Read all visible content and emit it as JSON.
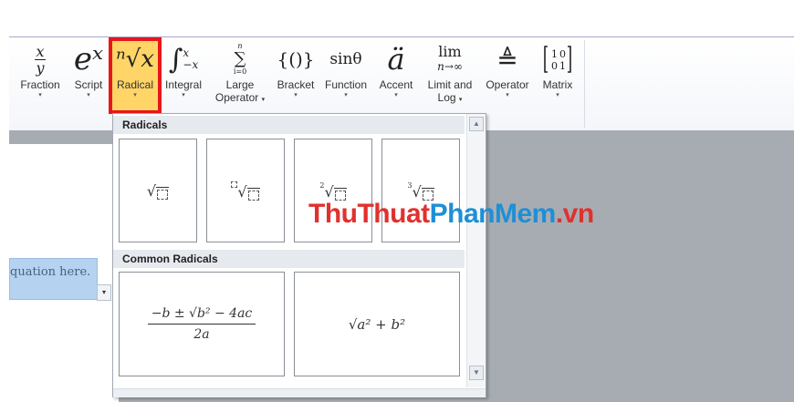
{
  "ribbon": {
    "buttons": [
      {
        "name": "fraction",
        "label": "Fraction",
        "arrow": "▾",
        "sym_top": "x",
        "sym_bottom": "y"
      },
      {
        "name": "script",
        "label": "Script",
        "arrow": "▾",
        "sym": "eˣ"
      },
      {
        "name": "radical",
        "label": "Radical",
        "arrow": "▾",
        "sym": "ⁿ√x"
      },
      {
        "name": "integral",
        "label": "Integral",
        "arrow": "▾",
        "sym": "∫"
      },
      {
        "name": "large-operator",
        "label": "Large",
        "label2": "Operator",
        "arrow": "▾",
        "sym": "∑"
      },
      {
        "name": "bracket",
        "label": "Bracket",
        "arrow": "▾",
        "sym": "{()}"
      },
      {
        "name": "function",
        "label": "Function",
        "arrow": "▾",
        "sym": "sinθ"
      },
      {
        "name": "accent",
        "label": "Accent",
        "arrow": "▾",
        "sym": "ä"
      },
      {
        "name": "limit-log",
        "label": "Limit and",
        "label2": "Log",
        "arrow": "▾",
        "sym": "lim"
      },
      {
        "name": "operator",
        "label": "Operator",
        "arrow": "▾",
        "sym": "≜"
      },
      {
        "name": "matrix",
        "label": "Matrix",
        "arrow": "▾",
        "sym": "[10;01]"
      }
    ]
  },
  "document": {
    "equation_placeholder": "quation here."
  },
  "dropdown": {
    "section1_title": "Radicals",
    "section2_title": "Common Radicals",
    "common": {
      "quadratic": "−b ± √b² − 4ac",
      "quadratic_den": "2a",
      "pythag": "√a² + b²"
    }
  },
  "watermark": {
    "part_a": "ThuThuat",
    "part_b": "PhanMem",
    "part_c": ".vn"
  },
  "colors": {
    "highlight": "#ffd567",
    "active_outline": "#e8161b",
    "watermark_red": "#e0312e",
    "watermark_blue": "#1d8fd6"
  }
}
